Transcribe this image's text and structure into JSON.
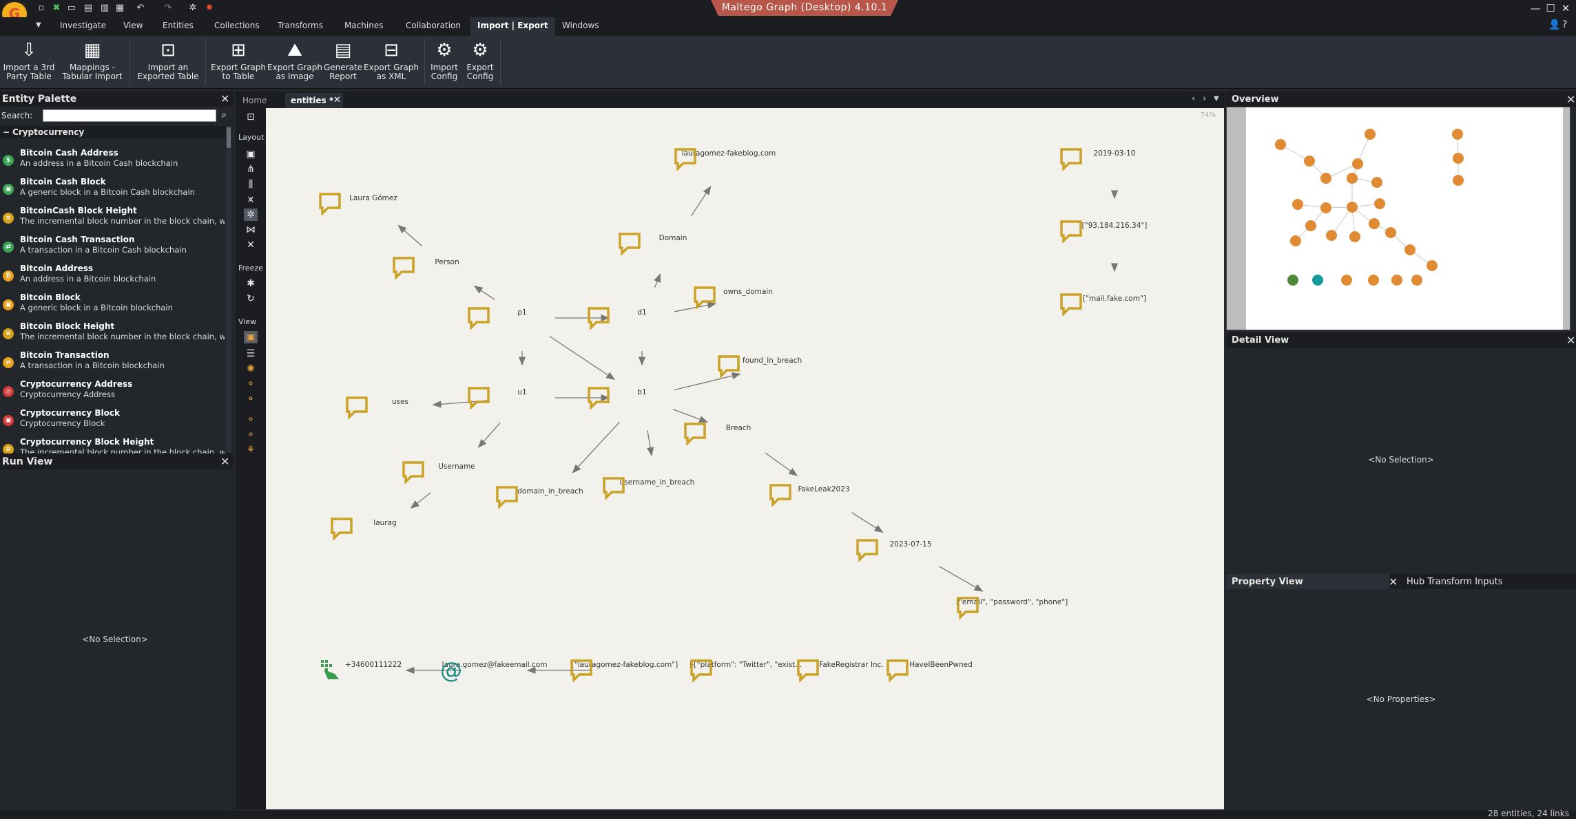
{
  "app": {
    "title": "Maltego Graph (Desktop) 4.10.1",
    "logo_text": "G"
  },
  "menu": {
    "items": [
      "Investigate",
      "View",
      "Entities",
      "Collections",
      "Transforms",
      "Machines",
      "Collaboration",
      "Import | Export",
      "Windows"
    ],
    "active": "Import | Export"
  },
  "ribbon": {
    "buttons": [
      {
        "line1": "Import a 3rd",
        "line2": "Party Table",
        "icon": "import-table-icon"
      },
      {
        "line1": "Mappings -",
        "line2": "Tabular Import",
        "icon": "mappings-icon"
      },
      {
        "line1": "Import an",
        "line2": "Exported Table",
        "icon": "import-exported-icon"
      },
      {
        "line1": "Export Graph",
        "line2": "to Table",
        "icon": "export-table-icon"
      },
      {
        "line1": "Export Graph",
        "line2": "as Image",
        "icon": "export-image-icon"
      },
      {
        "line1": "Generate",
        "line2": "Report",
        "icon": "report-icon"
      },
      {
        "line1": "Export Graph",
        "line2": "as XML",
        "icon": "export-xml-icon"
      },
      {
        "line1": "Import",
        "line2": "Config",
        "icon": "import-config-icon"
      },
      {
        "line1": "Export",
        "line2": "Config",
        "icon": "export-config-icon"
      }
    ]
  },
  "palette": {
    "title": "Entity Palette",
    "search_label": "Search:",
    "search_value": "",
    "category": "Cryptocurrency",
    "items": [
      {
        "name": "Bitcoin Cash Address",
        "desc": "An address in a Bitcoin Cash blockchain",
        "color": "#3aa757",
        "glyph": "$"
      },
      {
        "name": "Bitcoin Cash Block",
        "desc": "A generic block in a Bitcoin Cash blockchain",
        "color": "#3aa757",
        "glyph": "▣"
      },
      {
        "name": "BitcoinCash Block Height",
        "desc": "The incremental block number in the block chain, wh",
        "color": "#d9a21b",
        "glyph": "≡"
      },
      {
        "name": "Bitcoin Cash Transaction",
        "desc": "A transaction in a Bitcoin Cash blockchain",
        "color": "#3aa757",
        "glyph": "⇄"
      },
      {
        "name": "Bitcoin Address",
        "desc": "An address in a Bitcoin blockchain",
        "color": "#e8a21b",
        "glyph": "₿"
      },
      {
        "name": "Bitcoin Block",
        "desc": "A generic block in a Bitcoin blockchain",
        "color": "#e8a21b",
        "glyph": "▣"
      },
      {
        "name": "Bitcoin Block Height",
        "desc": "The incremental block number in the block chain, wh",
        "color": "#d9a21b",
        "glyph": "≡"
      },
      {
        "name": "Bitcoin Transaction",
        "desc": "A transaction in a Bitcoin blockchain",
        "color": "#e8a21b",
        "glyph": "⇄"
      },
      {
        "name": "Cryptocurrency Address",
        "desc": "Cryptocurrency Address",
        "color": "#d23a3a",
        "glyph": "◎"
      },
      {
        "name": "Cryptocurrency Block",
        "desc": "Cryptocurrency Block",
        "color": "#d23a3a",
        "glyph": "▣"
      },
      {
        "name": "Cryptocurrency Block Height",
        "desc": "The incremental block number in the block chain, wh",
        "color": "#d9a21b",
        "glyph": "≡"
      }
    ]
  },
  "runview": {
    "title": "Run View",
    "empty_text": "<No Selection>"
  },
  "tabs": {
    "home": "Home",
    "graph": "entities *"
  },
  "toolbar": {
    "layout_label": "Layout",
    "freeze_label": "Freeze",
    "view_label": "View"
  },
  "graph": {
    "zoom": "74%",
    "nodes": [
      {
        "id": "laura",
        "label": "Laura Gómez",
        "type": "chat"
      },
      {
        "id": "blog",
        "label": "lauragomez-fakeblog.com",
        "type": "chat"
      },
      {
        "id": "date1",
        "label": "2019-03-10",
        "type": "chat"
      },
      {
        "id": "person",
        "label": "Person",
        "type": "chat"
      },
      {
        "id": "domain",
        "label": "Domain",
        "type": "chat"
      },
      {
        "id": "ip",
        "label": "[\"93.184.216.34\"]",
        "type": "chat"
      },
      {
        "id": "owns",
        "label": "owns_domain",
        "type": "chat"
      },
      {
        "id": "p1",
        "label": "p1",
        "type": "chat"
      },
      {
        "id": "d1",
        "label": "d1",
        "type": "chat"
      },
      {
        "id": "mail",
        "label": "[\"mail.fake.com\"]",
        "type": "chat"
      },
      {
        "id": "fib",
        "label": "found_in_breach",
        "type": "chat"
      },
      {
        "id": "uses",
        "label": "uses",
        "type": "chat"
      },
      {
        "id": "u1",
        "label": "u1",
        "type": "chat"
      },
      {
        "id": "b1",
        "label": "b1",
        "type": "chat"
      },
      {
        "id": "breach",
        "label": "Breach",
        "type": "chat"
      },
      {
        "id": "username",
        "label": "Username",
        "type": "chat"
      },
      {
        "id": "fakeleak",
        "label": "FakeLeak2023",
        "type": "chat"
      },
      {
        "id": "dib",
        "label": "domain_in_breach",
        "type": "chat"
      },
      {
        "id": "uib",
        "label": "username_in_breach",
        "type": "chat"
      },
      {
        "id": "laurag",
        "label": "laurag",
        "type": "chat"
      },
      {
        "id": "date2",
        "label": "2023-07-15",
        "type": "chat"
      },
      {
        "id": "fields",
        "label": "[\"email\", \"password\", \"phone\"]",
        "type": "chat"
      },
      {
        "id": "phone",
        "label": "+34600111222",
        "type": "phone"
      },
      {
        "id": "email",
        "label": "laura.gomez@fakeemail.com",
        "type": "email"
      },
      {
        "id": "blog2",
        "label": "[\"lauragomez-fakeblog.com\"]",
        "type": "chat"
      },
      {
        "id": "platform",
        "label": "[{\"platform\": \"Twitter\", \"exist...",
        "type": "chat"
      },
      {
        "id": "registrar",
        "label": "FakeRegistrar Inc.",
        "type": "chat"
      },
      {
        "id": "hibp",
        "label": "HaveIBeenPwned",
        "type": "chat"
      }
    ]
  },
  "right": {
    "overview_title": "Overview",
    "detail_title": "Detail View",
    "detail_empty": "<No Selection>",
    "property_title": "Property View",
    "hub_tab": "Hub Transform Inputs",
    "property_empty": "<No Properties>"
  },
  "colors": {
    "node_accent": "#c9a227",
    "overview_node": "#e08b33",
    "overview_green": "#4f8a3a",
    "overview_teal": "#169a9a",
    "title_accent": "#b9564a"
  },
  "status": {
    "text": "28 entities, 24 links"
  }
}
